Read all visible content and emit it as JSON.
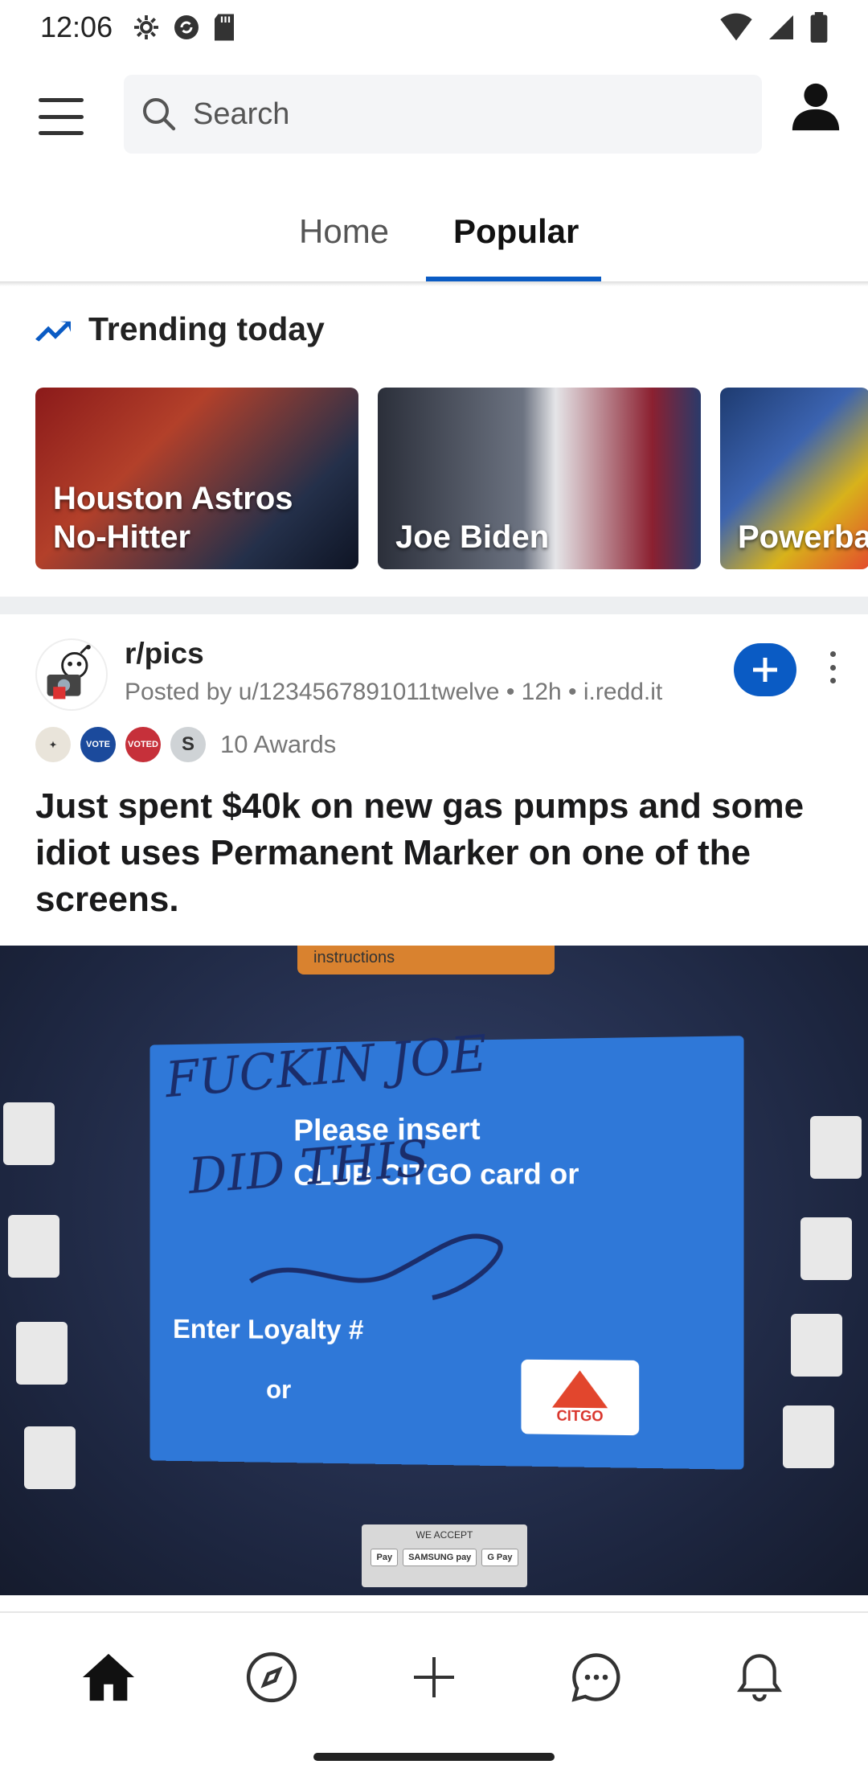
{
  "status_bar": {
    "time": "12:06"
  },
  "header": {
    "search_placeholder": "Search"
  },
  "tabs": [
    {
      "label": "Home"
    },
    {
      "label": "Popular"
    }
  ],
  "trending": {
    "title": "Trending today",
    "cards": [
      {
        "label": "Houston Astros\nNo-Hitter"
      },
      {
        "label": "Joe Biden"
      },
      {
        "label": "Powerba"
      }
    ]
  },
  "post": {
    "subreddit": "r/pics",
    "meta": "Posted by u/1234567891011twelve • 12h • i.redd.it",
    "awards_count": "10 Awards",
    "title": "Just spent $40k on new gas pumps and some idiot uses Permanent Marker on one of the screens.",
    "image_text": {
      "top_label": "instructions",
      "line1": "Please insert",
      "line2": "CLUB CITGO card or",
      "line3": "Enter Loyalty #",
      "line4": "or",
      "brand": "CITGO",
      "scribble1": "FUCKIN JOE",
      "scribble2": "DID THIS",
      "accept_label": "WE ACCEPT",
      "pay1": "Pay",
      "pay2": "SAMSUNG pay",
      "pay3": "G Pay"
    }
  },
  "colors": {
    "accent": "#0a5bc4",
    "divider": "#edeff1"
  }
}
